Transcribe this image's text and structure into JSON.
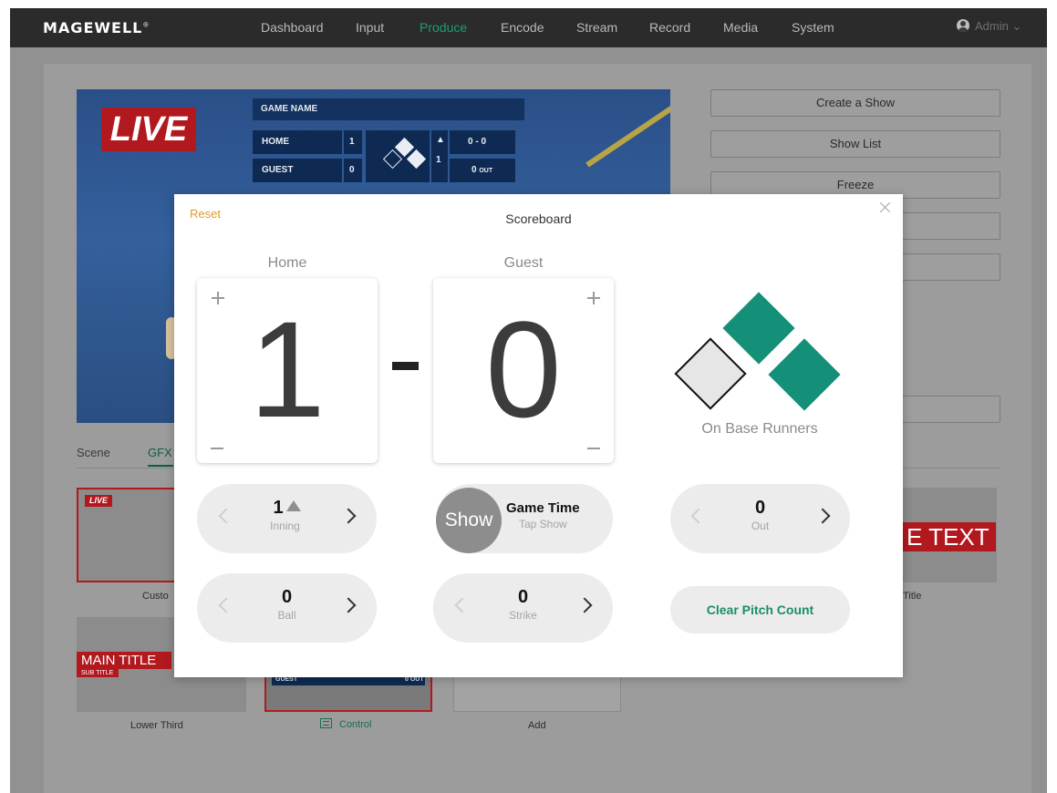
{
  "nav": {
    "logo": "MAGEWELL",
    "logo_mark": "®",
    "items": [
      "Dashboard",
      "Input",
      "Produce",
      "Encode",
      "Stream",
      "Record",
      "Media",
      "System"
    ],
    "active": "Produce",
    "user": "Admin",
    "active_color": "#1a9f78"
  },
  "preview": {
    "live": "LIVE",
    "scoreboard": {
      "game_name": "GAME NAME",
      "home": "HOME",
      "guest": "GUEST",
      "home_score": "1",
      "guest_score": "0",
      "inning": "1",
      "count": "0 - 0",
      "outs": "0",
      "outs_unit": "OUT"
    }
  },
  "side_buttons": [
    "Create a Show",
    "Show List",
    "Freeze"
  ],
  "background_tabs": {
    "scene": "Scene",
    "gfx": "GFX"
  },
  "cards": {
    "custom_label": "Custo",
    "live_badge": "LIVE",
    "text_banner": "E TEXT",
    "title_label": "Title",
    "lower_third": {
      "main": "MAIN TITLE",
      "sub": "SUB TITLE",
      "label": "Lower Third"
    },
    "control_label": "Control",
    "add_label": "Add",
    "mini_guest": "GUEST",
    "mini_out": "0 OUT"
  },
  "modal": {
    "reset": "Reset",
    "title": "Scoreboard",
    "home_label": "Home",
    "guest_label": "Guest",
    "home_score": "1",
    "guest_score": "0",
    "on_base_label": "On Base Runners",
    "bases": {
      "first": true,
      "second": true,
      "third": false
    },
    "base_colors": {
      "occupied": "#139077",
      "empty": "#e6e6e6"
    },
    "inning": {
      "value": "1",
      "label": "Inning",
      "half": "top"
    },
    "game_time": {
      "show": "Show",
      "title": "Game Time",
      "sub": "Tap Show"
    },
    "out": {
      "value": "0",
      "label": "Out"
    },
    "ball": {
      "value": "0",
      "label": "Ball"
    },
    "strike": {
      "value": "0",
      "label": "Strike"
    },
    "clear": "Clear Pitch Count"
  }
}
